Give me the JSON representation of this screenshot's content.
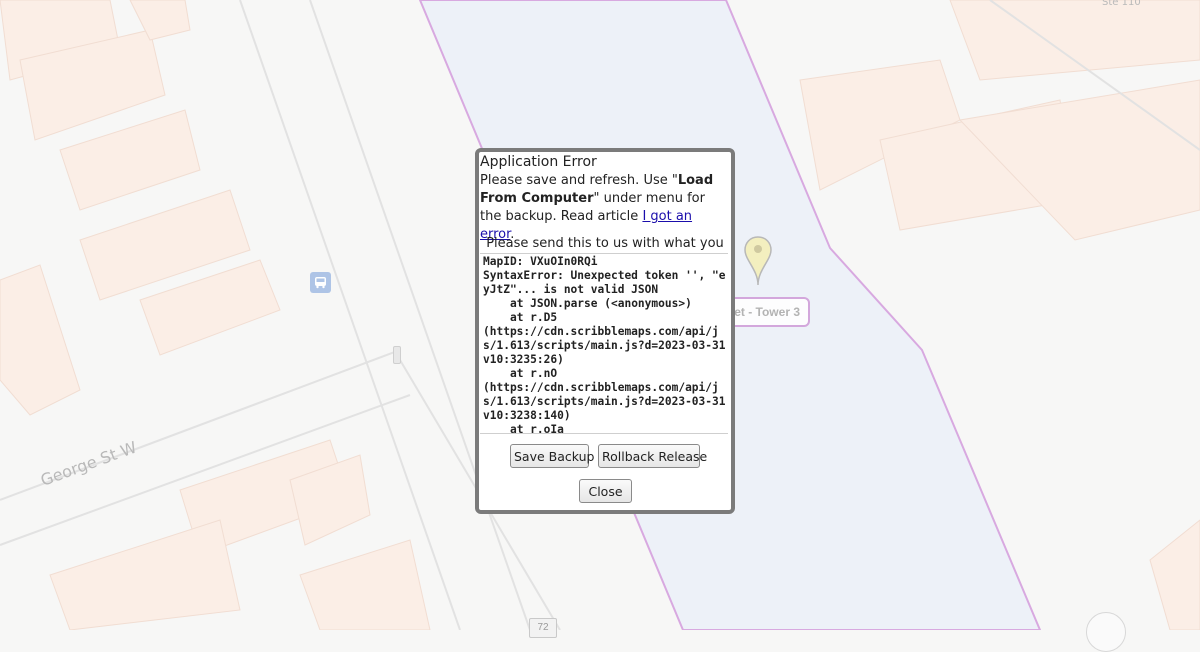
{
  "map": {
    "street_label": "George St W",
    "suite_label": "Ste 110",
    "route_number": "72",
    "place_label": "eet - Tower 3",
    "icons": [
      "bus-stop-icon",
      "traffic-light-icon",
      "map-marker-icon"
    ],
    "colors": {
      "background": "#f7f7f6",
      "highlight_fill": "#edf1f8",
      "highlight_border": "#d3a7dc",
      "buildings": "#fbeee6",
      "marker": "#f3efbf"
    }
  },
  "dialog": {
    "title": "Application Error",
    "msg_part1": "Please save and refresh. Use \"",
    "msg_bold": "Load From Computer",
    "msg_part2": "\" under menu for the backup. Read article ",
    "msg_link": "I got an error",
    "msg_end": ".",
    "send_note": "Please send this to us with what you",
    "trace": "MapID: VXuOIn0RQi\nSyntaxError: Unexpected token '', \"eyJtZ\"... is not valid JSON\n    at JSON.parse (<anonymous>)\n    at r.D5\n(https://cdn.scribblemaps.com/api/js/1.613/scripts/main.js?d=2023-03-31v10:3235:26)\n    at r.nO\n(https://cdn.scribblemaps.com/api/js/1.613/scripts/main.js?d=2023-03-31v10:3238:140)\n    at r.oIa",
    "buttons": {
      "save_backup": "Save Backup",
      "rollback_release": "Rollback Release",
      "close": "Close"
    }
  }
}
